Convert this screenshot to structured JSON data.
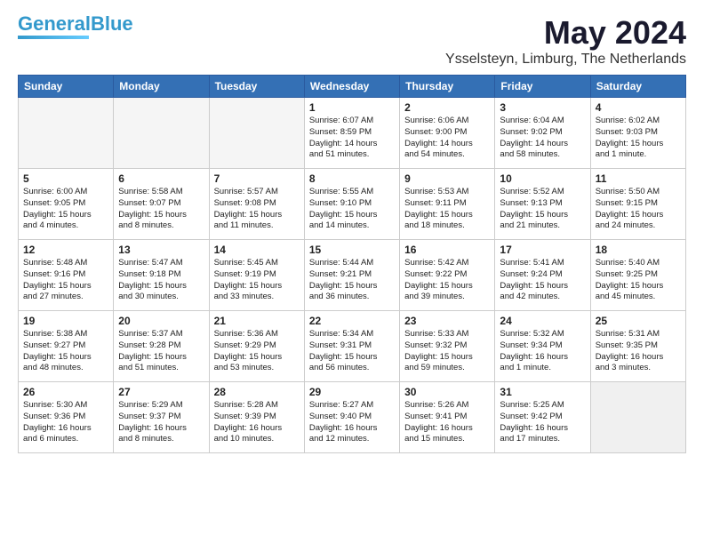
{
  "logo": {
    "part1": "General",
    "part2": "Blue"
  },
  "title": {
    "month_year": "May 2024",
    "location": "Ysselsteyn, Limburg, The Netherlands"
  },
  "weekdays": [
    "Sunday",
    "Monday",
    "Tuesday",
    "Wednesday",
    "Thursday",
    "Friday",
    "Saturday"
  ],
  "weeks": [
    [
      {
        "day": "",
        "text": "",
        "empty": true
      },
      {
        "day": "",
        "text": "",
        "empty": true
      },
      {
        "day": "",
        "text": "",
        "empty": true
      },
      {
        "day": "1",
        "text": "Sunrise: 6:07 AM\nSunset: 8:59 PM\nDaylight: 14 hours\nand 51 minutes.",
        "empty": false
      },
      {
        "day": "2",
        "text": "Sunrise: 6:06 AM\nSunset: 9:00 PM\nDaylight: 14 hours\nand 54 minutes.",
        "empty": false
      },
      {
        "day": "3",
        "text": "Sunrise: 6:04 AM\nSunset: 9:02 PM\nDaylight: 14 hours\nand 58 minutes.",
        "empty": false
      },
      {
        "day": "4",
        "text": "Sunrise: 6:02 AM\nSunset: 9:03 PM\nDaylight: 15 hours\nand 1 minute.",
        "empty": false
      }
    ],
    [
      {
        "day": "5",
        "text": "Sunrise: 6:00 AM\nSunset: 9:05 PM\nDaylight: 15 hours\nand 4 minutes.",
        "empty": false
      },
      {
        "day": "6",
        "text": "Sunrise: 5:58 AM\nSunset: 9:07 PM\nDaylight: 15 hours\nand 8 minutes.",
        "empty": false
      },
      {
        "day": "7",
        "text": "Sunrise: 5:57 AM\nSunset: 9:08 PM\nDaylight: 15 hours\nand 11 minutes.",
        "empty": false
      },
      {
        "day": "8",
        "text": "Sunrise: 5:55 AM\nSunset: 9:10 PM\nDaylight: 15 hours\nand 14 minutes.",
        "empty": false
      },
      {
        "day": "9",
        "text": "Sunrise: 5:53 AM\nSunset: 9:11 PM\nDaylight: 15 hours\nand 18 minutes.",
        "empty": false
      },
      {
        "day": "10",
        "text": "Sunrise: 5:52 AM\nSunset: 9:13 PM\nDaylight: 15 hours\nand 21 minutes.",
        "empty": false
      },
      {
        "day": "11",
        "text": "Sunrise: 5:50 AM\nSunset: 9:15 PM\nDaylight: 15 hours\nand 24 minutes.",
        "empty": false
      }
    ],
    [
      {
        "day": "12",
        "text": "Sunrise: 5:48 AM\nSunset: 9:16 PM\nDaylight: 15 hours\nand 27 minutes.",
        "empty": false
      },
      {
        "day": "13",
        "text": "Sunrise: 5:47 AM\nSunset: 9:18 PM\nDaylight: 15 hours\nand 30 minutes.",
        "empty": false
      },
      {
        "day": "14",
        "text": "Sunrise: 5:45 AM\nSunset: 9:19 PM\nDaylight: 15 hours\nand 33 minutes.",
        "empty": false
      },
      {
        "day": "15",
        "text": "Sunrise: 5:44 AM\nSunset: 9:21 PM\nDaylight: 15 hours\nand 36 minutes.",
        "empty": false
      },
      {
        "day": "16",
        "text": "Sunrise: 5:42 AM\nSunset: 9:22 PM\nDaylight: 15 hours\nand 39 minutes.",
        "empty": false
      },
      {
        "day": "17",
        "text": "Sunrise: 5:41 AM\nSunset: 9:24 PM\nDaylight: 15 hours\nand 42 minutes.",
        "empty": false
      },
      {
        "day": "18",
        "text": "Sunrise: 5:40 AM\nSunset: 9:25 PM\nDaylight: 15 hours\nand 45 minutes.",
        "empty": false
      }
    ],
    [
      {
        "day": "19",
        "text": "Sunrise: 5:38 AM\nSunset: 9:27 PM\nDaylight: 15 hours\nand 48 minutes.",
        "empty": false
      },
      {
        "day": "20",
        "text": "Sunrise: 5:37 AM\nSunset: 9:28 PM\nDaylight: 15 hours\nand 51 minutes.",
        "empty": false
      },
      {
        "day": "21",
        "text": "Sunrise: 5:36 AM\nSunset: 9:29 PM\nDaylight: 15 hours\nand 53 minutes.",
        "empty": false
      },
      {
        "day": "22",
        "text": "Sunrise: 5:34 AM\nSunset: 9:31 PM\nDaylight: 15 hours\nand 56 minutes.",
        "empty": false
      },
      {
        "day": "23",
        "text": "Sunrise: 5:33 AM\nSunset: 9:32 PM\nDaylight: 15 hours\nand 59 minutes.",
        "empty": false
      },
      {
        "day": "24",
        "text": "Sunrise: 5:32 AM\nSunset: 9:34 PM\nDaylight: 16 hours\nand 1 minute.",
        "empty": false
      },
      {
        "day": "25",
        "text": "Sunrise: 5:31 AM\nSunset: 9:35 PM\nDaylight: 16 hours\nand 3 minutes.",
        "empty": false
      }
    ],
    [
      {
        "day": "26",
        "text": "Sunrise: 5:30 AM\nSunset: 9:36 PM\nDaylight: 16 hours\nand 6 minutes.",
        "empty": false
      },
      {
        "day": "27",
        "text": "Sunrise: 5:29 AM\nSunset: 9:37 PM\nDaylight: 16 hours\nand 8 minutes.",
        "empty": false
      },
      {
        "day": "28",
        "text": "Sunrise: 5:28 AM\nSunset: 9:39 PM\nDaylight: 16 hours\nand 10 minutes.",
        "empty": false
      },
      {
        "day": "29",
        "text": "Sunrise: 5:27 AM\nSunset: 9:40 PM\nDaylight: 16 hours\nand 12 minutes.",
        "empty": false
      },
      {
        "day": "30",
        "text": "Sunrise: 5:26 AM\nSunset: 9:41 PM\nDaylight: 16 hours\nand 15 minutes.",
        "empty": false
      },
      {
        "day": "31",
        "text": "Sunrise: 5:25 AM\nSunset: 9:42 PM\nDaylight: 16 hours\nand 17 minutes.",
        "empty": false
      },
      {
        "day": "",
        "text": "",
        "empty": true
      }
    ]
  ]
}
